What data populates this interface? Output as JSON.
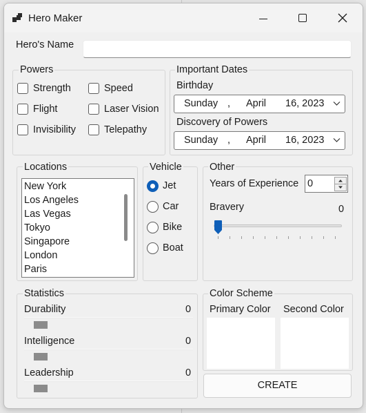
{
  "window": {
    "title": "Hero Maker"
  },
  "name_field": {
    "label": "Hero's Name",
    "value": ""
  },
  "powers": {
    "title": "Powers",
    "items": [
      {
        "label": "Strength",
        "checked": false
      },
      {
        "label": "Speed",
        "checked": false
      },
      {
        "label": "Flight",
        "checked": false
      },
      {
        "label": "Laser Vision",
        "checked": false
      },
      {
        "label": "Invisibility",
        "checked": false
      },
      {
        "label": "Telepathy",
        "checked": false
      }
    ]
  },
  "dates": {
    "title": "Important Dates",
    "birthday": {
      "label": "Birthday",
      "day": "Sunday",
      "comma": ",",
      "month": "April",
      "date": "16, 2023"
    },
    "discovery": {
      "label": "Discovery of Powers",
      "day": "Sunday",
      "comma": ",",
      "month": "April",
      "date": "16, 2023"
    }
  },
  "locations": {
    "title": "Locations",
    "items": [
      "New York",
      "Los Angeles",
      "Las Vegas",
      "Tokyo",
      "Singapore",
      "London",
      "Paris"
    ]
  },
  "vehicle": {
    "title": "Vehicle",
    "selected": "Jet",
    "options": [
      "Jet",
      "Car",
      "Bike",
      "Boat"
    ]
  },
  "other": {
    "title": "Other",
    "experience_label": "Years of Experience",
    "experience_value": "0",
    "bravery_label": "Bravery",
    "bravery_value": "0"
  },
  "statistics": {
    "title": "Statistics",
    "items": [
      {
        "label": "Durability",
        "value": "0"
      },
      {
        "label": "Intelligence",
        "value": "0"
      },
      {
        "label": "Leadership",
        "value": "0"
      }
    ]
  },
  "color_scheme": {
    "title": "Color Scheme",
    "primary_label": "Primary Color",
    "second_label": "Second Color",
    "primary_color": "#ffffff",
    "second_color": "#ffffff"
  },
  "create_button": {
    "label": "CREATE"
  },
  "colors": {
    "accent": "#0f5fb8",
    "window_bg": "#f0f0f0"
  }
}
